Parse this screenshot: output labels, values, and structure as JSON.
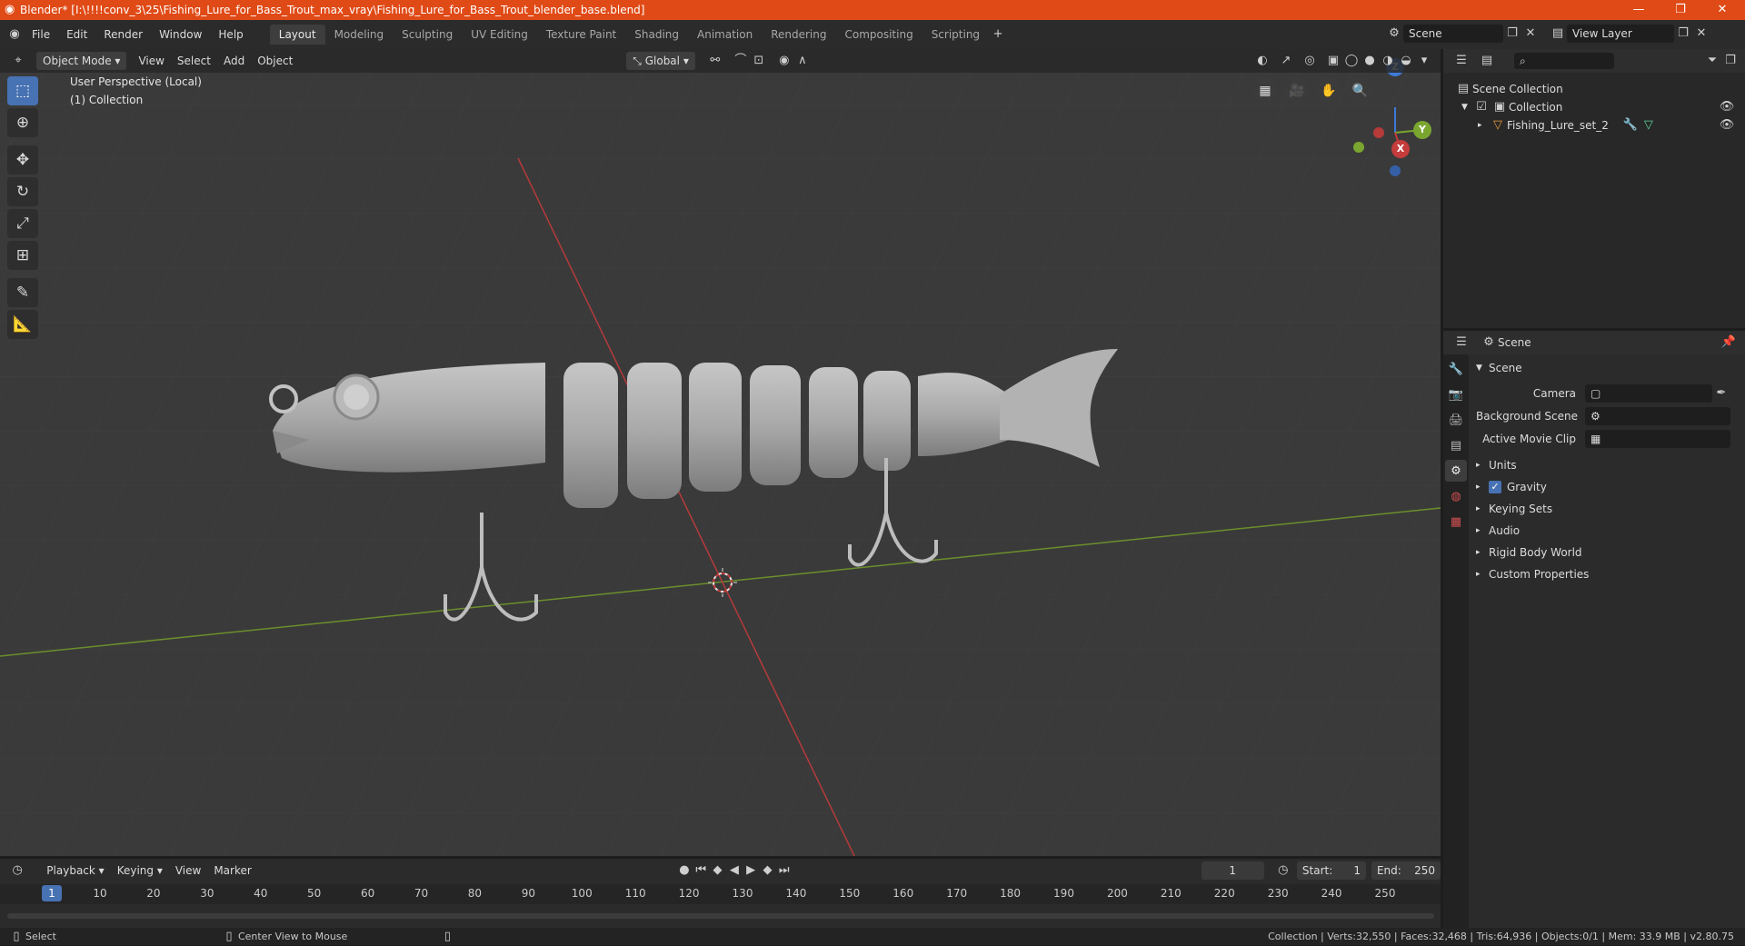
{
  "title": "Blender* [I:\\!!!!conv_3\\25\\Fishing_Lure_for_Bass_Trout_max_vray\\Fishing_Lure_for_Bass_Trout_blender_base.blend]",
  "menu": [
    "File",
    "Edit",
    "Render",
    "Window",
    "Help"
  ],
  "workspaces": [
    "Layout",
    "Modeling",
    "Sculpting",
    "UV Editing",
    "Texture Paint",
    "Shading",
    "Animation",
    "Rendering",
    "Compositing",
    "Scripting"
  ],
  "active_workspace": "Layout",
  "scene_name": "Scene",
  "view_layer": "View Layer",
  "viewport": {
    "mode": "Object Mode",
    "menus": [
      "View",
      "Select",
      "Add",
      "Object"
    ],
    "orientation": "Global",
    "perspective_label": "User Perspective (Local)",
    "collection_label": "(1) Collection",
    "gizmo_axes": {
      "z": "Z",
      "y": "Y",
      "x": "X"
    }
  },
  "outliner": {
    "root": "Scene Collection",
    "collection": "Collection",
    "object": "Fishing_Lure_set_2"
  },
  "properties": {
    "header": "Scene",
    "panel": "Scene",
    "fields": [
      {
        "label": "Camera"
      },
      {
        "label": "Background Scene"
      },
      {
        "label": "Active Movie Clip"
      }
    ],
    "sections": [
      "Units",
      "Gravity",
      "Keying Sets",
      "Audio",
      "Rigid Body World",
      "Custom Properties"
    ]
  },
  "timeline": {
    "menus": [
      "Playback",
      "Keying",
      "View",
      "Marker"
    ],
    "current_frame": "1",
    "start_label": "Start:",
    "start": "1",
    "end_label": "End:",
    "end": "250",
    "ticks": [
      "1",
      "10",
      "20",
      "30",
      "40",
      "50",
      "60",
      "70",
      "80",
      "90",
      "100",
      "110",
      "120",
      "130",
      "140",
      "150",
      "160",
      "170",
      "180",
      "190",
      "200",
      "210",
      "220",
      "230",
      "240",
      "250"
    ]
  },
  "status": {
    "select": "Select",
    "center_view": "Center View to Mouse",
    "stats": "Collection | Verts:32,550 | Faces:32,468 | Tris:64,936 | Objects:0/1 | Mem: 33.9 MB | v2.80.75"
  },
  "colors": {
    "titlebar": "#e04a16",
    "accent": "#4772b3",
    "x_axis": "#c43c3c",
    "y_axis": "#7aa630",
    "z_axis": "#3d7ad6"
  }
}
